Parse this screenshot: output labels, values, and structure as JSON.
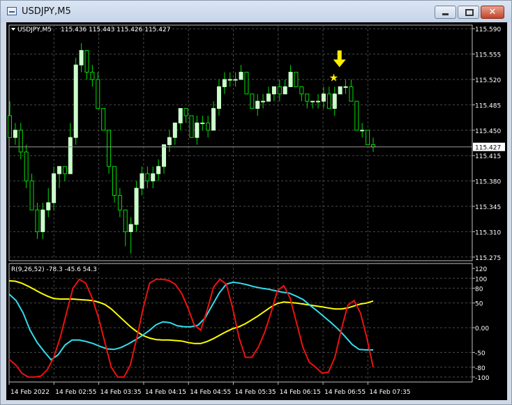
{
  "window": {
    "title": "USDJPY,M5",
    "min_icon": "minimize-icon",
    "max_icon": "maximize-icon",
    "close_icon": "close-icon",
    "close_glyph": "✕"
  },
  "colors": {
    "background": "#000000",
    "grid": "#4a4a4a",
    "text": "#ffffff",
    "bull_fill": "#ccffcc",
    "bear_fill": "#000000",
    "wick": "#00e000",
    "line_yellow": "#ffff00",
    "line_cyan": "#33ddee",
    "line_red": "#ee1111",
    "price_tag_bg": "#ffffff",
    "price_tag_text": "#000000",
    "arrow": "#ffee00"
  },
  "chart_data": [
    {
      "type": "candlestick",
      "title": "USDJPY,M5",
      "ohlc_header": "115.436 115.443 115.426 115.427",
      "ylim": [
        115.27,
        115.595
      ],
      "yticks": [
        "115.590",
        "115.555",
        "115.520",
        "115.485",
        "115.450",
        "115.415",
        "115.380",
        "115.345",
        "115.310",
        "115.275"
      ],
      "current_price": "115.427",
      "arrow_icon": "down-arrow-icon",
      "star_icon": "star-icon",
      "candles": [
        {
          "o": 115.47,
          "h": 115.49,
          "l": 115.44,
          "c": 115.44
        },
        {
          "o": 115.44,
          "h": 115.46,
          "l": 115.43,
          "c": 115.45
        },
        {
          "o": 115.45,
          "h": 115.46,
          "l": 115.41,
          "c": 115.42
        },
        {
          "o": 115.42,
          "h": 115.43,
          "l": 115.37,
          "c": 115.38
        },
        {
          "o": 115.38,
          "h": 115.39,
          "l": 115.34,
          "c": 115.34
        },
        {
          "o": 115.34,
          "h": 115.35,
          "l": 115.3,
          "c": 115.31
        },
        {
          "o": 115.31,
          "h": 115.35,
          "l": 115.3,
          "c": 115.34
        },
        {
          "o": 115.34,
          "h": 115.37,
          "l": 115.33,
          "c": 115.35
        },
        {
          "o": 115.35,
          "h": 115.4,
          "l": 115.34,
          "c": 115.39
        },
        {
          "o": 115.39,
          "h": 115.4,
          "l": 115.37,
          "c": 115.4
        },
        {
          "o": 115.4,
          "h": 115.4,
          "l": 115.38,
          "c": 115.39
        },
        {
          "o": 115.39,
          "h": 115.46,
          "l": 115.39,
          "c": 115.44
        },
        {
          "o": 115.44,
          "h": 115.55,
          "l": 115.43,
          "c": 115.54
        },
        {
          "o": 115.54,
          "h": 115.57,
          "l": 115.53,
          "c": 115.56
        },
        {
          "o": 115.56,
          "h": 115.56,
          "l": 115.52,
          "c": 115.53
        },
        {
          "o": 115.53,
          "h": 115.54,
          "l": 115.51,
          "c": 115.52
        },
        {
          "o": 115.52,
          "h": 115.53,
          "l": 115.48,
          "c": 115.48
        },
        {
          "o": 115.48,
          "h": 115.48,
          "l": 115.45,
          "c": 115.45
        },
        {
          "o": 115.45,
          "h": 115.45,
          "l": 115.39,
          "c": 115.4
        },
        {
          "o": 115.4,
          "h": 115.4,
          "l": 115.35,
          "c": 115.36
        },
        {
          "o": 115.36,
          "h": 115.37,
          "l": 115.33,
          "c": 115.34
        },
        {
          "o": 115.34,
          "h": 115.34,
          "l": 115.29,
          "c": 115.31
        },
        {
          "o": 115.31,
          "h": 115.33,
          "l": 115.28,
          "c": 115.32
        },
        {
          "o": 115.32,
          "h": 115.38,
          "l": 115.31,
          "c": 115.37
        },
        {
          "o": 115.37,
          "h": 115.4,
          "l": 115.36,
          "c": 115.39
        },
        {
          "o": 115.39,
          "h": 115.4,
          "l": 115.37,
          "c": 115.38
        },
        {
          "o": 115.38,
          "h": 115.4,
          "l": 115.37,
          "c": 115.39
        },
        {
          "o": 115.39,
          "h": 115.41,
          "l": 115.38,
          "c": 115.4
        },
        {
          "o": 115.4,
          "h": 115.43,
          "l": 115.39,
          "c": 115.43
        },
        {
          "o": 115.43,
          "h": 115.45,
          "l": 115.42,
          "c": 115.44
        },
        {
          "o": 115.44,
          "h": 115.46,
          "l": 115.43,
          "c": 115.46
        },
        {
          "o": 115.46,
          "h": 115.48,
          "l": 115.45,
          "c": 115.48
        },
        {
          "o": 115.48,
          "h": 115.48,
          "l": 115.46,
          "c": 115.47
        },
        {
          "o": 115.47,
          "h": 115.47,
          "l": 115.44,
          "c": 115.44
        },
        {
          "o": 115.44,
          "h": 115.47,
          "l": 115.43,
          "c": 115.46
        },
        {
          "o": 115.46,
          "h": 115.47,
          "l": 115.45,
          "c": 115.46
        },
        {
          "o": 115.46,
          "h": 115.47,
          "l": 115.44,
          "c": 115.45
        },
        {
          "o": 115.45,
          "h": 115.49,
          "l": 115.45,
          "c": 115.48
        },
        {
          "o": 115.48,
          "h": 115.52,
          "l": 115.47,
          "c": 115.51
        },
        {
          "o": 115.51,
          "h": 115.53,
          "l": 115.5,
          "c": 115.52
        },
        {
          "o": 115.52,
          "h": 115.53,
          "l": 115.51,
          "c": 115.52
        },
        {
          "o": 115.52,
          "h": 115.53,
          "l": 115.51,
          "c": 115.52
        },
        {
          "o": 115.52,
          "h": 115.54,
          "l": 115.52,
          "c": 115.53
        },
        {
          "o": 115.53,
          "h": 115.53,
          "l": 115.5,
          "c": 115.5
        },
        {
          "o": 115.5,
          "h": 115.5,
          "l": 115.48,
          "c": 115.48
        },
        {
          "o": 115.48,
          "h": 115.5,
          "l": 115.47,
          "c": 115.49
        },
        {
          "o": 115.49,
          "h": 115.5,
          "l": 115.48,
          "c": 115.49
        },
        {
          "o": 115.49,
          "h": 115.51,
          "l": 115.49,
          "c": 115.5
        },
        {
          "o": 115.5,
          "h": 115.51,
          "l": 115.49,
          "c": 115.51
        },
        {
          "o": 115.51,
          "h": 115.52,
          "l": 115.49,
          "c": 115.5
        },
        {
          "o": 115.5,
          "h": 115.52,
          "l": 115.5,
          "c": 115.51
        },
        {
          "o": 115.51,
          "h": 115.54,
          "l": 115.51,
          "c": 115.53
        },
        {
          "o": 115.53,
          "h": 115.53,
          "l": 115.51,
          "c": 115.51
        },
        {
          "o": 115.51,
          "h": 115.51,
          "l": 115.49,
          "c": 115.5
        },
        {
          "o": 115.5,
          "h": 115.5,
          "l": 115.48,
          "c": 115.49
        },
        {
          "o": 115.49,
          "h": 115.49,
          "l": 115.48,
          "c": 115.49
        },
        {
          "o": 115.49,
          "h": 115.5,
          "l": 115.48,
          "c": 115.49
        },
        {
          "o": 115.49,
          "h": 115.51,
          "l": 115.48,
          "c": 115.5
        },
        {
          "o": 115.5,
          "h": 115.51,
          "l": 115.48,
          "c": 115.48
        },
        {
          "o": 115.48,
          "h": 115.51,
          "l": 115.47,
          "c": 115.5
        },
        {
          "o": 115.5,
          "h": 115.51,
          "l": 115.5,
          "c": 115.51
        },
        {
          "o": 115.51,
          "h": 115.52,
          "l": 115.5,
          "c": 115.51
        },
        {
          "o": 115.51,
          "h": 115.52,
          "l": 115.49,
          "c": 115.49
        },
        {
          "o": 115.49,
          "h": 115.49,
          "l": 115.45,
          "c": 115.45
        },
        {
          "o": 115.45,
          "h": 115.46,
          "l": 115.44,
          "c": 115.45
        },
        {
          "o": 115.45,
          "h": 115.45,
          "l": 115.43,
          "c": 115.43
        },
        {
          "o": 115.43,
          "h": 115.44,
          "l": 115.42,
          "c": 115.427
        }
      ]
    },
    {
      "type": "line",
      "title": "R(9,26,52) -78.3 -45.6 54.3",
      "ylim": [
        -110,
        130
      ],
      "yticks": [
        "120",
        "100",
        "80",
        "50",
        "0.00",
        "-50",
        "-80",
        "-100"
      ],
      "series": [
        {
          "color": "#ffff00",
          "values": [
            95,
            94,
            90,
            84,
            77,
            70,
            64,
            59,
            58,
            58,
            58,
            57,
            56,
            55,
            52,
            47,
            38,
            26,
            14,
            2,
            -8,
            -16,
            -21,
            -24,
            -25,
            -25,
            -26,
            -27,
            -30,
            -32,
            -32,
            -28,
            -22,
            -15,
            -8,
            -2,
            2,
            8,
            16,
            24,
            33,
            42,
            49,
            52,
            51,
            50,
            48,
            46,
            44,
            42,
            40,
            38,
            38,
            40,
            44,
            48,
            50,
            54
          ]
        },
        {
          "color": "#33ddee",
          "values": [
            68,
            55,
            30,
            -5,
            -30,
            -48,
            -65,
            -55,
            -35,
            -25,
            -25,
            -28,
            -32,
            -38,
            -43,
            -44,
            -40,
            -33,
            -25,
            -16,
            -6,
            6,
            12,
            10,
            4,
            2,
            2,
            5,
            20,
            45,
            70,
            88,
            92,
            90,
            87,
            83,
            80,
            78,
            75,
            72,
            70,
            64,
            57,
            45,
            34,
            22,
            10,
            -3,
            -18,
            -34,
            -44,
            -45,
            -45
          ]
        },
        {
          "color": "#ee1111",
          "values": [
            -64,
            -75,
            -92,
            -100,
            -100,
            -98,
            -85,
            -60,
            -20,
            30,
            80,
            98,
            90,
            60,
            20,
            -30,
            -80,
            -100,
            -100,
            -75,
            -20,
            40,
            90,
            98,
            98,
            96,
            88,
            70,
            40,
            5,
            -5,
            35,
            82,
            98,
            88,
            40,
            -20,
            -60,
            -60,
            -40,
            -10,
            30,
            75,
            85,
            60,
            10,
            -40,
            -70,
            -80,
            -92,
            -90,
            -60,
            -5,
            45,
            55,
            30,
            -20,
            -80
          ]
        }
      ]
    }
  ],
  "xticks": [
    "14 Feb 2022",
    "14 Feb 02:55",
    "14 Feb 03:35",
    "14 Feb 04:15",
    "14 Feb 04:55",
    "14 Feb 05:35",
    "14 Feb 06:15",
    "14 Feb 06:55",
    "14 Feb 07:35"
  ]
}
